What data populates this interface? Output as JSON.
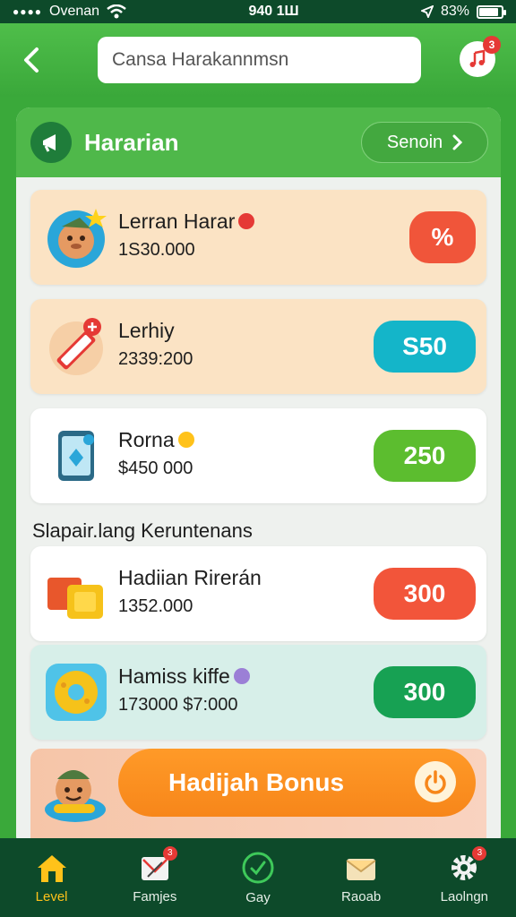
{
  "status_bar": {
    "carrier": "Ovenan",
    "time": "940 1Ш",
    "battery": "83%"
  },
  "header": {
    "search_placeholder": "Cansa Harakannmsn",
    "notification_count": "3"
  },
  "panel": {
    "title": "Hararian",
    "see_button": "Senoin",
    "cards": [
      {
        "name": "Lerran Harar",
        "value": "1S30.000",
        "action": "%",
        "action_color": "#f0553a",
        "bg": "#fbe3c4"
      },
      {
        "name": "Lerhiy",
        "value": "2339:200",
        "action": "S50",
        "action_color": "#14b5c9",
        "bg": "#fbe3c4"
      },
      {
        "name": "Rorna",
        "value": "$450 000",
        "action": "250",
        "action_color": "#5cbd2f",
        "bg": "#ffffff"
      }
    ],
    "section_title": "Slapair.lang Keruntenans",
    "section_cards": [
      {
        "name": "Hadiian Rirerán",
        "value": "1352.000",
        "action": "300",
        "action_color": "#f2553a",
        "bg": "#ffffff"
      },
      {
        "name": "Hamiss kiffe",
        "value": "173000 $7:000",
        "action": "300",
        "action_color": "#17a153",
        "bg": "#d7efe9"
      }
    ],
    "bonus_label": "Hadijah Bonus"
  },
  "bottom_nav": [
    {
      "label": "Level",
      "icon": "home-icon",
      "active": true
    },
    {
      "label": "Famjes",
      "icon": "mail-flag-icon",
      "badge": "3"
    },
    {
      "label": "Gay",
      "icon": "check-circle-icon"
    },
    {
      "label": "Raoab",
      "icon": "envelope-icon"
    },
    {
      "label": "Laolngn",
      "icon": "gear-icon",
      "badge": "3"
    }
  ],
  "colors": {
    "brand_green": "#3aa93a",
    "dark_green": "#0d4a2a",
    "accent_orange": "#f7861a",
    "active_nav": "#ffc21a"
  }
}
